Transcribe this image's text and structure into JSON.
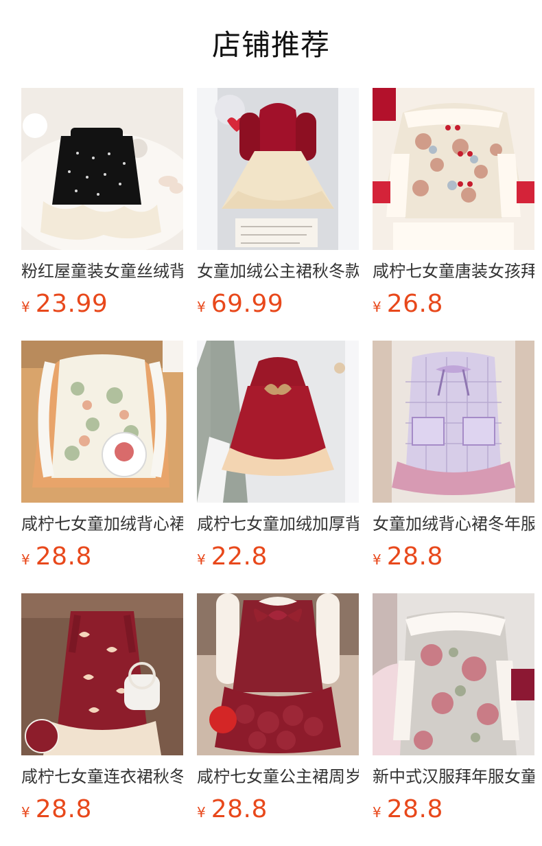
{
  "section": {
    "title": "店铺推荐"
  },
  "currency_symbol": "¥",
  "products": [
    {
      "name": "粉红屋童装女童丝绒背心裙",
      "price": "23.99",
      "image_icon": "black-velvet-dress-image"
    },
    {
      "name": "女童加绒公主裙秋冬款",
      "price": "69.99",
      "image_icon": "red-tulle-dress-image"
    },
    {
      "name": "咸柠七女童唐装女孩拜年服",
      "price": "26.8",
      "image_icon": "floral-tang-jacket-image"
    },
    {
      "name": "咸柠七女童加绒背心裙",
      "price": "28.8",
      "image_icon": "floral-cheongsam-vest-image"
    },
    {
      "name": "咸柠七女童加绒加厚背心裙",
      "price": "22.8",
      "image_icon": "red-sequin-dress-image"
    },
    {
      "name": "女童加绒背心裙冬年服",
      "price": "28.8",
      "image_icon": "purple-tweed-vest-dress-image"
    },
    {
      "name": "咸柠七女童连衣裙秋冬款",
      "price": "28.8",
      "image_icon": "red-bow-tweed-dress-image"
    },
    {
      "name": "咸柠七女童公主裙周岁礼服",
      "price": "28.8",
      "image_icon": "red-rose-dress-image"
    },
    {
      "name": "新中式汉服拜年服女童",
      "price": "28.8",
      "image_icon": "rose-print-cheongsam-image"
    }
  ],
  "colors": {
    "price": "#e8481b",
    "title": "#111111",
    "name": "#333333"
  }
}
